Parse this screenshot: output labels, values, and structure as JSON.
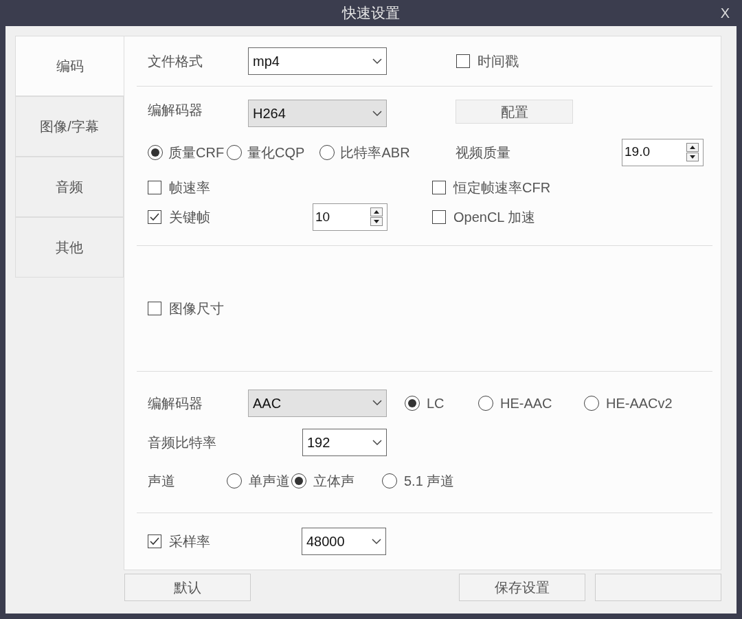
{
  "window": {
    "title": "快速设置",
    "close": "X"
  },
  "tabs": [
    {
      "label": "编码",
      "selected": true
    },
    {
      "label": "图像/字幕",
      "selected": false
    },
    {
      "label": "音频",
      "selected": false
    },
    {
      "label": "其他",
      "selected": false
    }
  ],
  "video": {
    "file_format": {
      "label": "文件格式",
      "value": "mp4"
    },
    "timestamp": {
      "label": "时间戳",
      "checked": false
    },
    "codec": {
      "label": "编解码器",
      "value": "H264"
    },
    "configure_button": "配置",
    "rate_modes": [
      {
        "label": "质量CRF",
        "selected": true
      },
      {
        "label": "量化CQP",
        "selected": false
      },
      {
        "label": "比特率ABR",
        "selected": false
      }
    ],
    "quality": {
      "label": "视频质量",
      "value": "19.0"
    },
    "frame_rate": {
      "label": "帧速率",
      "checked": false
    },
    "constant_frame_rate": {
      "label": "恒定帧速率CFR",
      "checked": false
    },
    "keyframe": {
      "label": "关键帧",
      "checked": true,
      "value": "10"
    },
    "opencl": {
      "label": "OpenCL 加速",
      "checked": false
    },
    "image_size": {
      "label": "图像尺寸",
      "checked": false
    }
  },
  "audio": {
    "codec": {
      "label": "编解码器",
      "value": "AAC"
    },
    "profiles": [
      {
        "label": "LC",
        "selected": true
      },
      {
        "label": "HE-AAC",
        "selected": false
      },
      {
        "label": "HE-AACv2",
        "selected": false
      }
    ],
    "bitrate": {
      "label": "音频比特率",
      "value": "192"
    },
    "channels": {
      "label": "声道",
      "options": [
        {
          "label": "单声道",
          "selected": false
        },
        {
          "label": "立体声",
          "selected": true
        },
        {
          "label": "5.1 声道",
          "selected": false
        }
      ]
    },
    "sample_rate": {
      "label": "采样率",
      "checked": true,
      "value": "48000"
    }
  },
  "buttons": [
    "默认",
    "保存设置"
  ]
}
